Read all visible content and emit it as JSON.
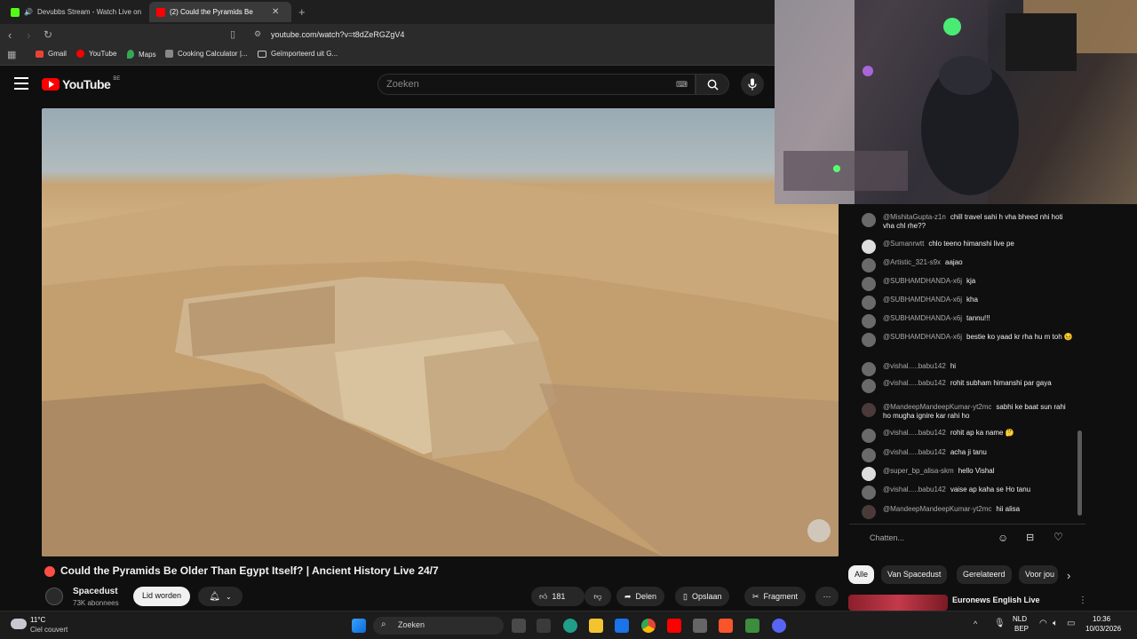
{
  "browser": {
    "tabs": [
      {
        "title": "Devubbs Stream - Watch Live on",
        "active": false
      },
      {
        "title": "(2)  Could the Pyramids Be",
        "active": true
      }
    ],
    "url": "youtube.com/watch?v=t8dZeRGZgV4",
    "bookmarks": [
      "Gmail",
      "YouTube",
      "Maps",
      "Cooking Calculator |...",
      "Geïmporteerd uit G..."
    ]
  },
  "youtube": {
    "logo": "YouTube",
    "country": "BE",
    "search_placeholder": "Zoeken"
  },
  "video": {
    "title": "Could the Pyramids Be Older Than Egypt Itself? | Ancient History Live 24/7",
    "channel": "Spacedust",
    "subscribers": "73K abonnees",
    "join_label": "Lid worden",
    "likes": "181",
    "share_label": "Delen",
    "save_label": "Opslaan",
    "clip_label": "Fragment"
  },
  "chat": {
    "messages": [
      {
        "author": "@MishitaGupta-z1n",
        "text": "chill travel sahi h vha bheed nhi hoti vha chl rhe??"
      },
      {
        "author": "@Sumanrwtt",
        "text": "chlo teeno himanshi live pe"
      },
      {
        "author": "@Artistic_321-s9x",
        "text": "aajao"
      },
      {
        "author": "@SUBHAMDHANDA-x6j",
        "text": "kja"
      },
      {
        "author": "@SUBHAMDHANDA-x6j",
        "text": "kha"
      },
      {
        "author": "@SUBHAMDHANDA-x6j",
        "text": "tannu!!!"
      },
      {
        "author": "@SUBHAMDHANDA-x6j",
        "text": "bestie ko yaad kr rha hu m toh 😣"
      },
      {
        "author": "@vishal.....babu142",
        "text": "hi"
      },
      {
        "author": "@vishal.....babu142",
        "text": "rohit subham himanshi par gaya"
      },
      {
        "author": "@MandeepMandeepKumar-yt2mc",
        "text": "sabhi ke baat sun rahi ho mugha ignire kar rahi ho"
      },
      {
        "author": "@vishal.....babu142",
        "text": "rohit ap ka name 🤔"
      },
      {
        "author": "@vishal.....babu142",
        "text": "acha ji tanu"
      },
      {
        "author": "@super_bp_alisa-skm",
        "text": "hello Vishal"
      },
      {
        "author": "@vishal.....babu142",
        "text": "vaise ap kaha se Ho tanu"
      },
      {
        "author": "@MandeepMandeepKumar-yt2mc",
        "text": "hii alisa"
      }
    ],
    "input_placeholder": "Chatten..."
  },
  "chips": [
    "Alle",
    "Van Spacedust",
    "Gerelateerd",
    "Voor jou"
  ],
  "recommended": {
    "title": "Euronews English Live"
  },
  "taskbar": {
    "weather_temp": "11°C",
    "weather_desc": "Ciel couvert",
    "search_label": "Zoeken",
    "lang": "NLD",
    "lang_sub": "BEP",
    "time": "10:36",
    "date": "10/03/2026"
  }
}
